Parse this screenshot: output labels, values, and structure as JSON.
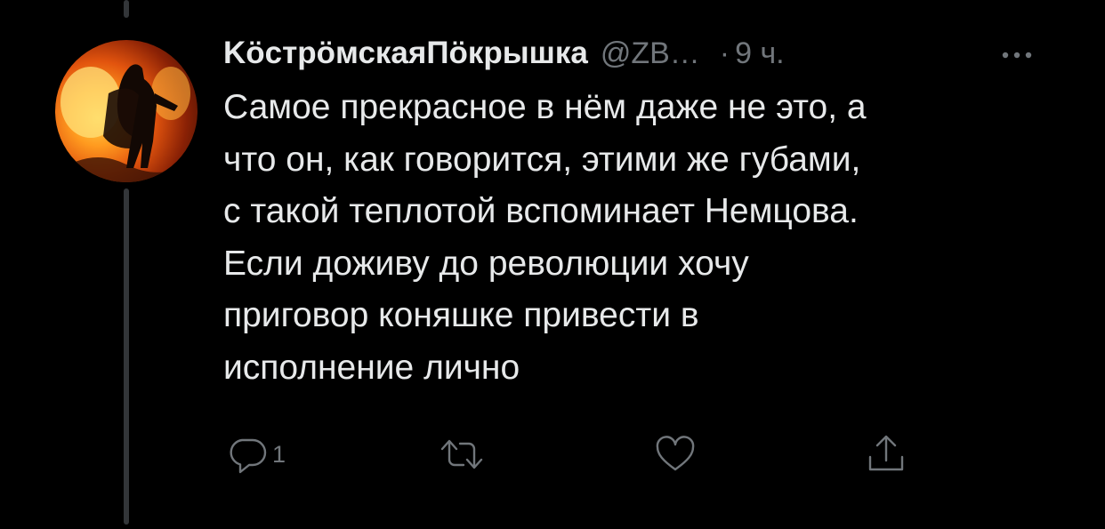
{
  "tweet": {
    "display_name": "KöстрöмскаяПöкрышка",
    "handle": "@ZB…",
    "separator": "·",
    "time": "9 ч.",
    "text_lines": [
      "Самое прекрасное в нём даже не это, а",
      "что он, как говорится, этими же губами,",
      "с такой теплотой вспоминает Немцова.",
      "Если доживу до революции хочу",
      "приговор коняшке привести в",
      "исполнение лично"
    ]
  },
  "actions": {
    "reply_icon": "reply-icon",
    "reply_count": "1",
    "retweet_icon": "retweet-icon",
    "like_icon": "heart-icon",
    "share_icon": "share-icon",
    "more_icon": "more-icon"
  },
  "colors": {
    "background": "#000000",
    "text": "#e7e9ea",
    "secondary": "#71767b",
    "thread_line": "#333639"
  }
}
